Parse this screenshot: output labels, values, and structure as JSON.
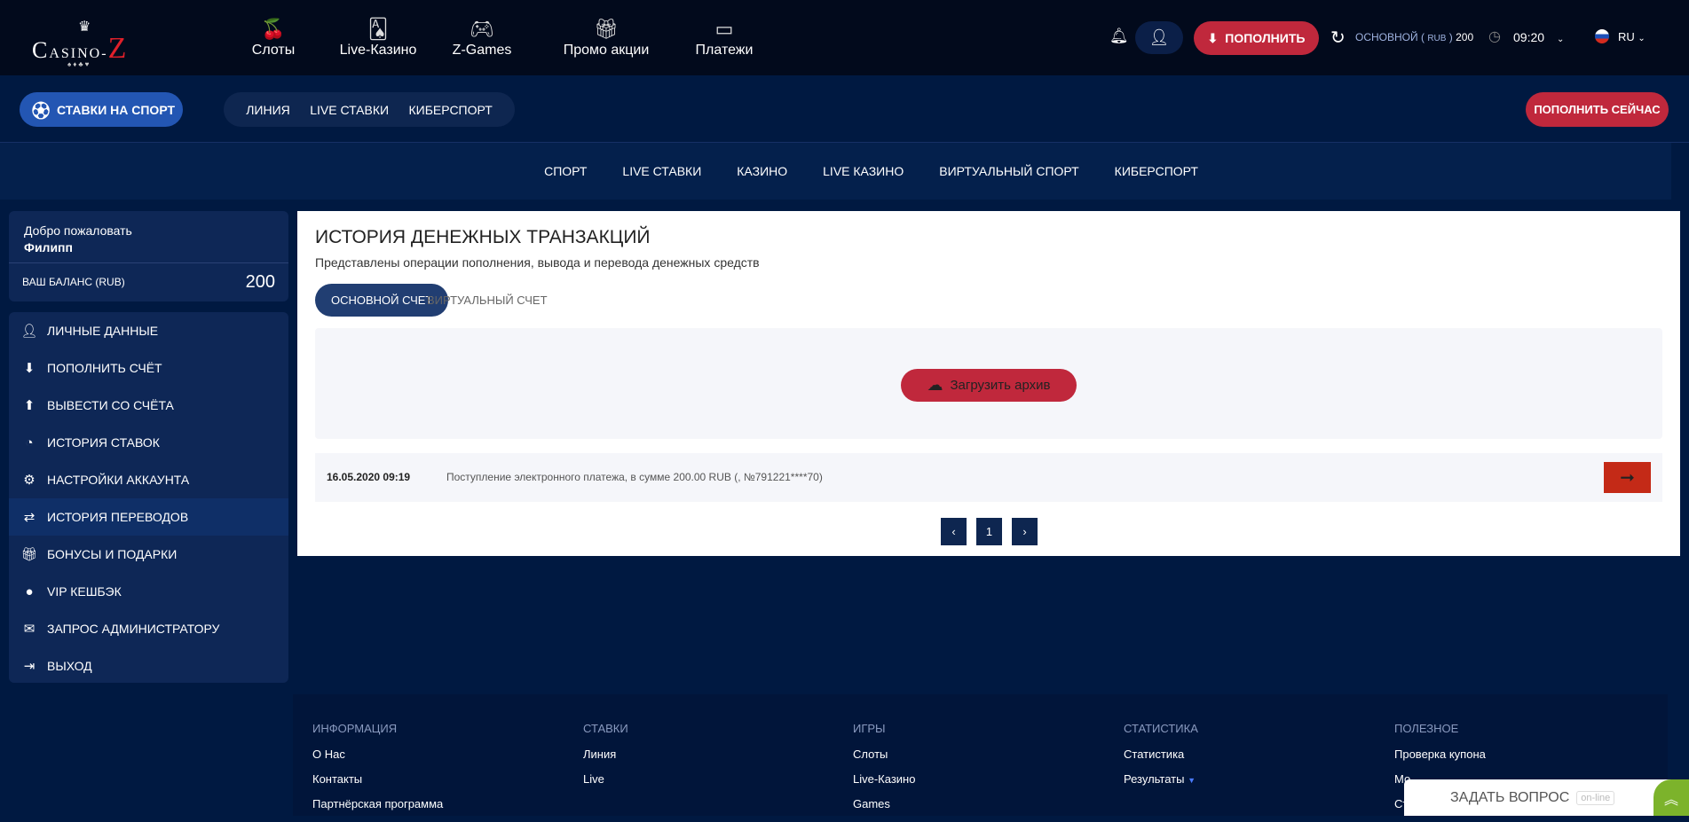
{
  "header": {
    "logo": "CASINO-Z",
    "nav": [
      {
        "icon": "cherry-icon",
        "label": "Слоты"
      },
      {
        "icon": "cards-icon",
        "label": "Live-Казино"
      },
      {
        "icon": "gamepad-icon",
        "label": "Z-Games"
      },
      {
        "icon": "gift-icon",
        "label": "Промо акции"
      },
      {
        "icon": "wallet-icon",
        "label": "Платежи"
      }
    ],
    "deposit": "ПОПОЛНИТЬ",
    "account": "ОСНОВНОЙ",
    "currency": "RUB",
    "balance": "200",
    "time": "09:20",
    "lang": "RU"
  },
  "subnav": {
    "sport_button": "СТАВКИ НА СПОРТ",
    "pills": [
      "ЛИНИЯ",
      "LIVE СТАВКИ",
      "КИБЕРСПОРТ"
    ],
    "deposit_now": "ПОПОЛНИТЬ СЕЙЧАС"
  },
  "catnav": [
    "СПОРТ",
    "LIVE СТАВКИ",
    "КАЗИНО",
    "LIVE КАЗИНО",
    "ВИРТУАЛЬНЫЙ СПОРТ",
    "КИБЕРСПОРТ"
  ],
  "sidebar": {
    "welcome": "Добро пожаловать",
    "username": "Филипп",
    "balance_label": "ВАШ БАЛАНС (RUB)",
    "balance": "200",
    "items": [
      {
        "icon": "user-plus-icon",
        "label": "ЛИЧНЫЕ ДАННЫЕ"
      },
      {
        "icon": "download-icon",
        "label": "ПОПОЛНИТЬ СЧЁТ"
      },
      {
        "icon": "upload-icon",
        "label": "ВЫВЕСТИ СО СЧЁТА"
      },
      {
        "icon": "clock-icon",
        "label": "ИСТОРИЯ СТАВОК"
      },
      {
        "icon": "gears-icon",
        "label": "НАСТРОЙКИ АККАУНТА"
      },
      {
        "icon": "transfer-icon",
        "label": "ИСТОРИЯ ПЕРЕВОДОВ"
      },
      {
        "icon": "gift-hand-icon",
        "label": "БОНУСЫ И ПОДАРКИ"
      },
      {
        "icon": "dot-icon",
        "label": "VIP КЕШБЭК"
      },
      {
        "icon": "envelope-icon",
        "label": "ЗАПРОС АДМИНИСТРАТОРУ"
      },
      {
        "icon": "logout-icon",
        "label": "ВЫХОД"
      }
    ]
  },
  "main": {
    "title": "ИСТОРИЯ ДЕНЕЖНЫХ ТРАНЗАКЦИЙ",
    "subtitle": "Представлены операции пополнения, вывода и перевода денежных средств",
    "tabs": [
      "ОСНОВНОЙ СЧЕТ",
      "ВИРТУАЛЬНЫЙ СЧЕТ"
    ],
    "download": "Загрузить архив",
    "rows": [
      {
        "date": "16.05.2020 09:19",
        "text": "Поступление электронного платежа, в сумме 200.00 RUB (, №791221****70)"
      }
    ],
    "pagination": {
      "prev": "‹",
      "page": "1",
      "next": "›"
    }
  },
  "footer": {
    "columns": [
      {
        "title": "ИНФОРМАЦИЯ",
        "links": [
          "О Нас",
          "Контакты",
          "Партнёрская программа"
        ]
      },
      {
        "title": "СТАВКИ",
        "links": [
          "Линия",
          "Live"
        ]
      },
      {
        "title": "ИГРЫ",
        "links": [
          "Слоты",
          "Live-Казино",
          "Games"
        ]
      },
      {
        "title": "СТАТИСТИКА",
        "links": [
          "Статистика",
          "Результаты"
        ]
      },
      {
        "title": "ПОЛЕЗНОЕ",
        "links": [
          "Проверка купона",
          "Мо",
          "Ст"
        ]
      }
    ]
  },
  "chat": {
    "label": "ЗАДАТЬ ВОПРОС",
    "status": "on-line"
  }
}
